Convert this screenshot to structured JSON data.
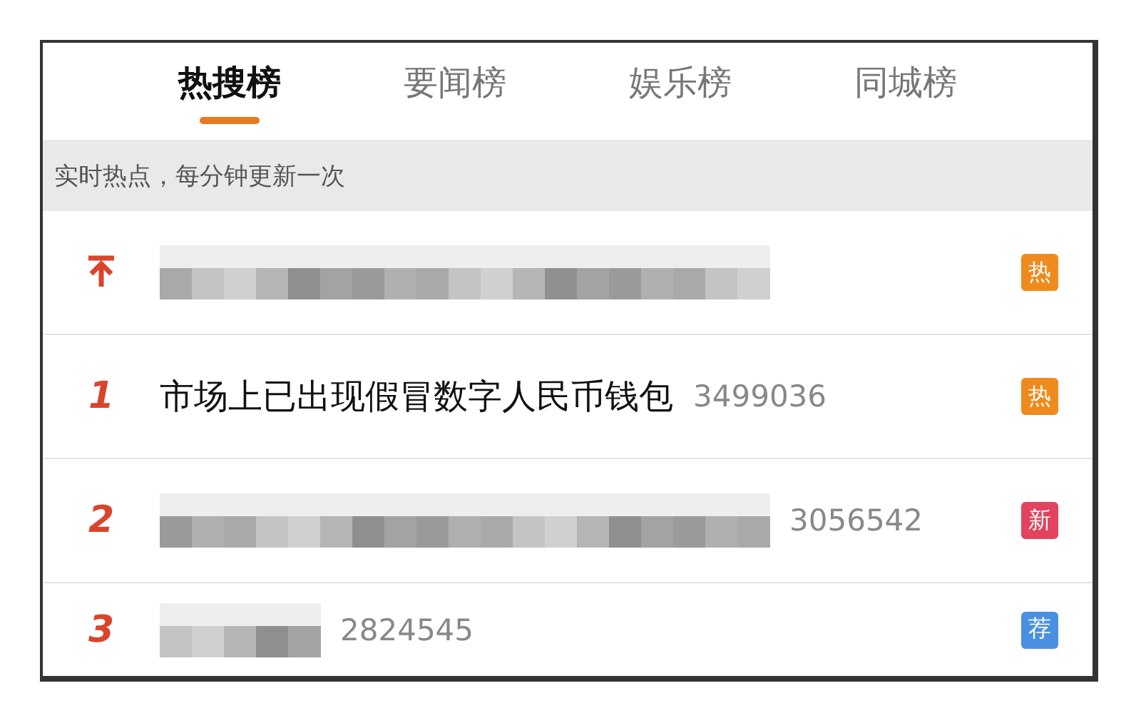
{
  "tabs": [
    {
      "label": "热搜榜",
      "selected": true
    },
    {
      "label": "要闻榜",
      "selected": false
    },
    {
      "label": "娱乐榜",
      "selected": false
    },
    {
      "label": "同城榜",
      "selected": false
    }
  ],
  "notice": "实时热点，每分钟更新一次",
  "rows": [
    {
      "kind": "pinned",
      "title": {
        "kind": "blurred"
      },
      "badge": {
        "label": "热",
        "color": "#ef8a1c"
      }
    },
    {
      "kind": "ranked",
      "rank": "1",
      "title": {
        "kind": "text",
        "text": "市场上已出现假冒数字人民币钱包"
      },
      "count": "3499036",
      "badge": {
        "label": "热",
        "color": "#ef8a1c"
      }
    },
    {
      "kind": "ranked",
      "rank": "2",
      "title": {
        "kind": "blurred"
      },
      "count": "3056542",
      "badge": {
        "label": "新",
        "color": "#e2435e"
      }
    },
    {
      "kind": "ranked",
      "rank": "3",
      "title": {
        "kind": "blurred"
      },
      "count": "2824545",
      "badge": {
        "label": "荐",
        "color": "#4a90e2"
      }
    }
  ]
}
